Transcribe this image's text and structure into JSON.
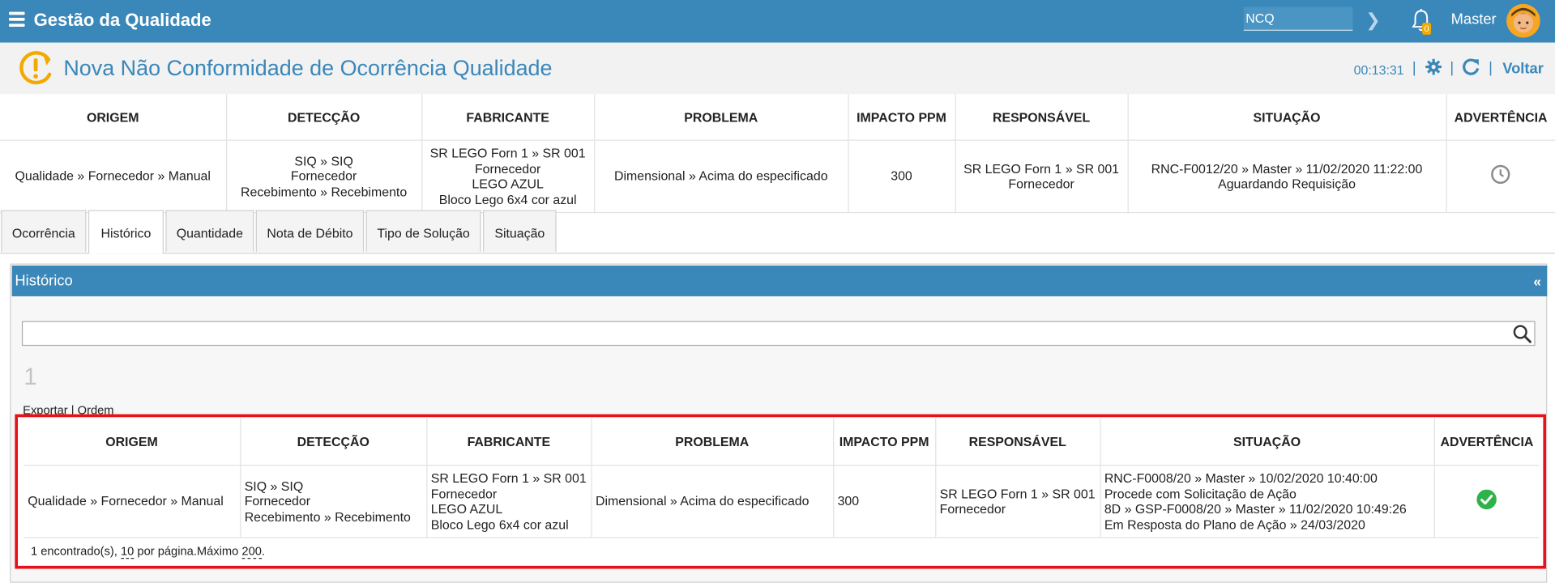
{
  "app": {
    "title": "Gestão da Qualidade",
    "module_value": "NCQ",
    "notification_count": "0",
    "user": "Master"
  },
  "page": {
    "title": "Nova Não Conformidade de Ocorrência Qualidade",
    "timer": "00:13:31",
    "separator": "|",
    "back_label": "Voltar"
  },
  "columns": [
    "ORIGEM",
    "DETECÇÃO",
    "FABRICANTE",
    "PROBLEMA",
    "IMPACTO PPM",
    "RESPONSÁVEL",
    "SITUAÇÃO",
    "ADVERTÊNCIA"
  ],
  "summary": {
    "origem": "Qualidade » Fornecedor » Manual",
    "deteccao": [
      "SIQ » SIQ",
      "Fornecedor",
      "Recebimento » Recebimento"
    ],
    "fabricante": [
      "SR LEGO Forn 1 » SR 001",
      "Fornecedor",
      "LEGO AZUL",
      "Bloco Lego 6x4 cor azul"
    ],
    "problema": "Dimensional » Acima do especificado",
    "impacto": "300",
    "responsavel": [
      "SR LEGO Forn 1 » SR 001",
      "Fornecedor"
    ],
    "situacao": [
      "RNC-F0012/20 » Master » 11/02/2020 11:22:00",
      "Aguardando Requisição"
    ],
    "advertencia_icon": "clock-icon"
  },
  "tabs": [
    {
      "label": "Ocorrência",
      "active": false
    },
    {
      "label": "Histórico",
      "active": true
    },
    {
      "label": "Quantidade",
      "active": false
    },
    {
      "label": "Nota de Débito",
      "active": false
    },
    {
      "label": "Tipo de Solução",
      "active": false
    },
    {
      "label": "Situação",
      "active": false
    }
  ],
  "panel": {
    "title": "Histórico",
    "collapse_label": "«",
    "search_value": "",
    "page_number": "1",
    "export_label": "Exportar",
    "order_label": "Ordem",
    "export_sep": " | "
  },
  "history": {
    "rows": [
      {
        "origem": "Qualidade » Fornecedor » Manual",
        "deteccao": [
          "SIQ » SIQ",
          "Fornecedor",
          "Recebimento » Recebimento"
        ],
        "fabricante": [
          "SR LEGO Forn 1 » SR 001",
          "Fornecedor",
          "LEGO AZUL",
          "Bloco Lego 6x4 cor azul"
        ],
        "problema": "Dimensional » Acima do especificado",
        "impacto": "300",
        "responsavel": [
          "SR LEGO Forn 1 » SR 001",
          "Fornecedor"
        ],
        "situacao": [
          "RNC-F0008/20 » Master » 10/02/2020 10:40:00",
          "Procede com Solicitação de Ação",
          "8D » GSP-F0008/20 » Master » 11/02/2020 10:49:26",
          "Em Resposta do Plano de Ação » 24/03/2020"
        ],
        "advertencia_icon": "check-circle-icon"
      }
    ],
    "footer": {
      "found_text": "1 encontrado(s), ",
      "per_page": "10",
      "per_page_text": " por página.Máximo ",
      "max": "200",
      "end": "."
    }
  },
  "colors": {
    "brand": "#3a87b9",
    "highlight": "#e8111a",
    "success": "#2db34a",
    "warning": "#f2a900"
  }
}
